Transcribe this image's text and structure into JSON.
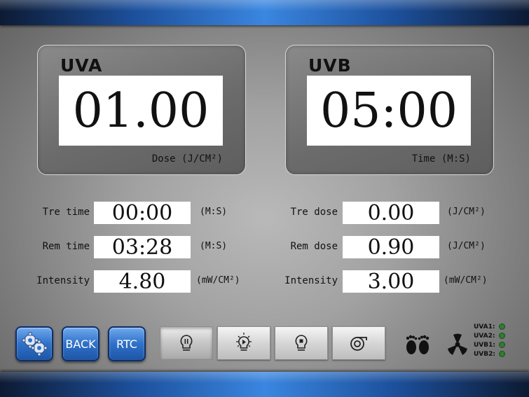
{
  "uva": {
    "title": "UVA",
    "value": "01.00",
    "unit": "Dose (J/CM²)"
  },
  "uvb": {
    "title": "UVB",
    "value": "05:00",
    "unit": "Time (M:S)"
  },
  "left_rows": [
    {
      "label": "Tre time",
      "value": "00:00",
      "unit": "(M:S)"
    },
    {
      "label": "Rem time",
      "value": "03:28",
      "unit": "(M:S)"
    },
    {
      "label": "Intensity",
      "value": "4.80",
      "unit": "(mW/CM²)"
    }
  ],
  "right_rows": [
    {
      "label": "Tre dose",
      "value": "0.00",
      "unit": "(J/CM²)"
    },
    {
      "label": "Rem dose",
      "value": "0.90",
      "unit": "(J/CM²)"
    },
    {
      "label": "Intensity",
      "value": "3.00",
      "unit": "(mW/CM²)"
    }
  ],
  "toolbar": {
    "settings_icon": "gear-icon",
    "back_label": "BACK",
    "rtc_label": "RTC",
    "lamp_buttons": [
      "lamp-pause-icon",
      "lamp-play-icon",
      "lamp-stop-icon",
      "fan-speed-icon"
    ]
  },
  "indicators": {
    "feet_icon": "feet-icon",
    "fan_icon": "fan-icon",
    "items": [
      {
        "label": "UVA1:",
        "color": "#2e7d32"
      },
      {
        "label": "UVA2:",
        "color": "#2e7d32"
      },
      {
        "label": "UVB1:",
        "color": "#2e7d32"
      },
      {
        "label": "UVB2:",
        "color": "#2e7d32"
      }
    ]
  },
  "colors": {
    "bar_accent": "#3a86e0",
    "button_blue": "#2f71c9",
    "indicator_green": "#2e7d32"
  }
}
